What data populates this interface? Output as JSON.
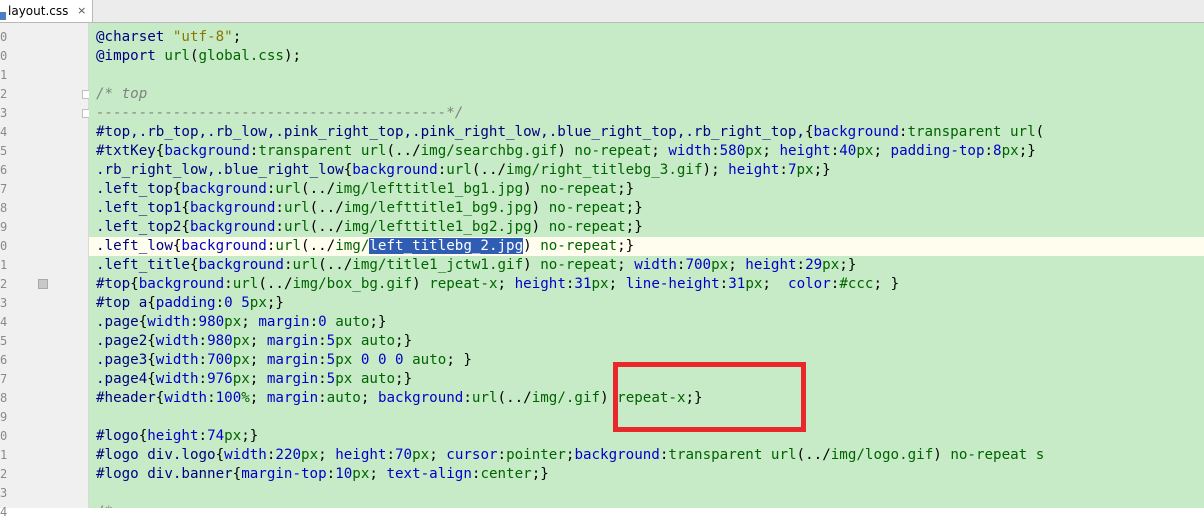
{
  "tab": {
    "label": "layout.css",
    "close": "×"
  },
  "gutter": {
    "line_numbers": [
      "0",
      "0",
      "1",
      "2",
      "3",
      "4",
      "5",
      "6",
      "7",
      "8",
      "9",
      "0",
      "1",
      "2",
      "3",
      "4",
      "5",
      "6",
      "7",
      "8",
      "9",
      "0",
      "1",
      "2",
      "3",
      "4"
    ]
  },
  "editor": {
    "current_line_index": 11,
    "selected_text": "left_titlebg_2.jpg",
    "lines": [
      {
        "text": "@charset \"utf-8\";"
      },
      {
        "text": "@import url(global.css);"
      },
      {
        "text": ""
      },
      {
        "text": "/* top"
      },
      {
        "text": "-----------------------------------------*/"
      },
      {
        "text": "#top,.rb_top,.rb_low,.pink_right_top,.pink_right_low,.blue_right_top,.rb_right_top,{background:transparent url("
      },
      {
        "text": "#txtKey{background:transparent url(../img/searchbg.gif) no-repeat; width:580px; height:40px; padding-top:8px;}"
      },
      {
        "text": ".rb_right_low,.blue_right_low{background:url(../img/right_titlebg_3.gif); height:7px;}"
      },
      {
        "text": ".left_top{background:url(../img/lefttitle1_bg1.jpg) no-repeat;}"
      },
      {
        "text": ".left_top1{background:url(../img/lefttitle1_bg9.jpg) no-repeat;}"
      },
      {
        "text": ".left_top2{background:url(../img/lefttitle1_bg2.jpg) no-repeat;}"
      },
      {
        "text": ".left_low{background:url(../img/left_titlebg_2.jpg) no-repeat;}"
      },
      {
        "text": ".left_title{background:url(../img/title1_jctw1.gif) no-repeat; width:700px; height:29px;}"
      },
      {
        "text": "#top{background:url(../img/box_bg.gif) repeat-x; height:31px; line-height:31px;  color:#ccc; }"
      },
      {
        "text": "#top a{padding:0 5px;}"
      },
      {
        "text": ".page{width:980px; margin:0 auto;}"
      },
      {
        "text": ".page2{width:980px; margin:5px auto;}"
      },
      {
        "text": ".page3{width:700px; margin:5px 0 0 0 auto; }"
      },
      {
        "text": ".page4{width:976px; margin:5px auto;}"
      },
      {
        "text": "#header{width:100%; margin:auto; background:url(../img/.gif) repeat-x;}"
      },
      {
        "text": ""
      },
      {
        "text": "#logo{height:74px;}"
      },
      {
        "text": "#logo div.logo{width:220px; height:70px; cursor:pointer;background:transparent url(../img/logo.gif) no-repeat s"
      },
      {
        "text": "#logo div.banner{margin-top:10px; text-align:center;}"
      },
      {
        "text": ""
      },
      {
        "text": "/* nav"
      }
    ]
  },
  "colors": {
    "editor_bg": "#c7ebc7",
    "gutter_bg": "#f0f0f0",
    "selection": "#2f5db4",
    "annotation": "#e8282c"
  }
}
